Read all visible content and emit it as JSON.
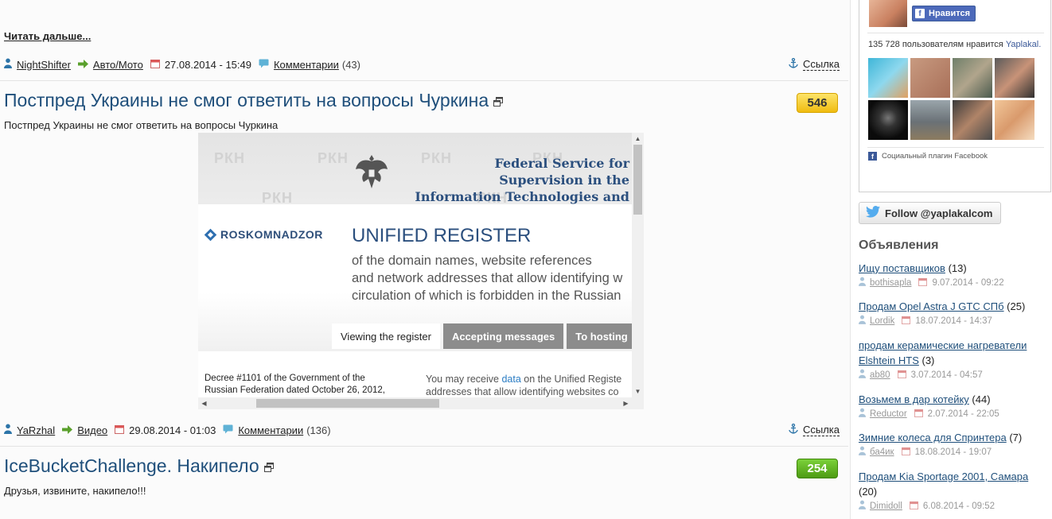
{
  "post1": {
    "read_more": "Читать дальше...",
    "author": "NightShifter",
    "category": "Авто/Мото",
    "date": "27.08.2014 - 15:49",
    "comments_label": "Комментарии",
    "comments_count": "(43)",
    "link_label": "Ссылка"
  },
  "post2": {
    "title": "Постпред Украины не смог ответить на вопросы Чуркина",
    "rating": "546",
    "lead": "Постпред Украины не смог ответить на вопросы Чуркина",
    "image": {
      "watermark": "РКН",
      "agency_title_1": "Federal Service for Supervision in the",
      "agency_title_2": "Information Technologies and Mass",
      "logo_text": "ROSKOMNADZOR",
      "register_title": "UNIFIED REGISTER",
      "register_sub_1": "of the domain names, website references",
      "register_sub_2": "and network addresses that allow identifying w",
      "register_sub_3": "circulation of which is forbidden in the Russian",
      "tabs": [
        "Viewing the register",
        "Accepting messages",
        "To hosting"
      ],
      "decree": "Decree #1101 of the Government of the Russian Federation dated October 26, 2012,",
      "you_may_1": "You may receive",
      "you_may_link": "data",
      "you_may_2": "on the Unified Registe",
      "you_may_3": "addresses that allow identifying websites co"
    },
    "author": "YaRzhal",
    "category": "Видео",
    "date": "29.08.2014 - 01:03",
    "comments_label": "Комментарии",
    "comments_count": "(136)",
    "link_label": "Ссылка"
  },
  "post3": {
    "title": "IceBucketChallenge. Накипело",
    "rating": "254",
    "lead": "Друзья, извините, накипело!!!"
  },
  "sidebar": {
    "fb_like_label": "Нравится",
    "fb_count_text": "135 728 пользователям нравится",
    "fb_page_name": "Yaplakal.",
    "fb_plugin_label": "Социальный плагин Facebook",
    "twitter_follow": "Follow @yaplakalcom",
    "ads_title": "Объявления",
    "ads": [
      {
        "title": "Ищу поставщиков",
        "count": "(13)",
        "author": "bothisapla",
        "date": "9.07.2014 - 09:22"
      },
      {
        "title": "Продам Opel Astra J GTC СПб",
        "count": "(25)",
        "author": "Lordik",
        "date": "18.07.2014 - 14:37"
      },
      {
        "title_1": "продам керамические нагреватели",
        "title_2": "Elshtein HTS",
        "count": "(3)",
        "author": "ab80",
        "date": "3.07.2014 - 04:57"
      },
      {
        "title": "Возьмем в дар котейку",
        "count": "(44)",
        "author": "Reductor",
        "date": "2.07.2014 - 22:05"
      },
      {
        "title": "Зимние колеса для Спринтера",
        "count": "(7)",
        "author": "ба4ик",
        "date": "18.08.2014 - 19:07"
      },
      {
        "title": "Продам Kia Sportage 2001, Самара",
        "count": "(20)",
        "author": "Dimidoll",
        "date": "6.08.2014 - 09:52"
      }
    ]
  },
  "colors": {
    "title_blue": "#1f4f7b",
    "rating_yellow": "#f0bc10",
    "rating_green": "#4d9b13",
    "facebook_blue": "#4c69ba",
    "twitter_blue": "#55acee"
  }
}
